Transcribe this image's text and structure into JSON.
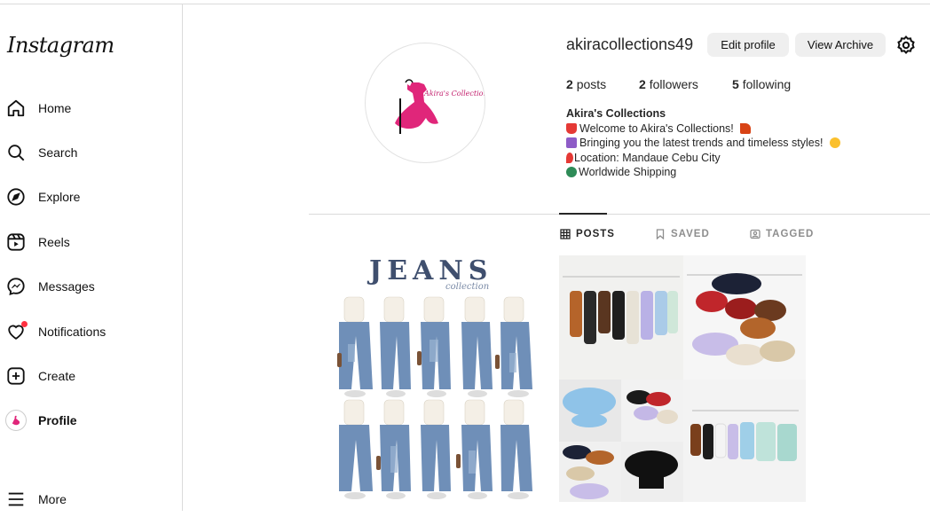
{
  "app": {
    "logo": "Instagram"
  },
  "sidebar": {
    "items": [
      {
        "label": "Home",
        "icon": "home-icon"
      },
      {
        "label": "Search",
        "icon": "search-icon"
      },
      {
        "label": "Explore",
        "icon": "compass-icon"
      },
      {
        "label": "Reels",
        "icon": "reels-icon"
      },
      {
        "label": "Messages",
        "icon": "messenger-icon"
      },
      {
        "label": "Notifications",
        "icon": "heart-icon",
        "badge": "dot"
      },
      {
        "label": "Create",
        "icon": "plus-square-icon"
      },
      {
        "label": "Profile",
        "icon": "avatar",
        "active": true
      },
      {
        "label": "More",
        "icon": "menu-icon"
      }
    ]
  },
  "profile": {
    "username": "akiracollections49",
    "edit_label": "Edit profile",
    "archive_label": "View Archive",
    "avatar_brand": "Akira's Collections",
    "stats": {
      "posts_count": "2",
      "posts_label": "posts",
      "followers_count": "2",
      "followers_label": "followers",
      "following_count": "5",
      "following_label": "following"
    },
    "bio": {
      "name": "Akira's Collections",
      "lines": [
        "Welcome to Akira's Collections!",
        "Bringing you the latest trends and timeless styles!",
        "Location: Mandaue Cebu City",
        "Worldwide Shipping"
      ]
    }
  },
  "tabs": [
    {
      "label": "POSTS",
      "active": true,
      "icon": "grid-icon"
    },
    {
      "label": "SAVED",
      "active": false,
      "icon": "bookmark-icon"
    },
    {
      "label": "TAGGED",
      "active": false,
      "icon": "tagged-icon"
    }
  ],
  "posts": [
    {
      "title": "JEANS",
      "subtitle": "collection"
    },
    {
      "title": ""
    }
  ],
  "colors": {
    "accent_pink": "#e0267a",
    "notification_red": "#ff3040",
    "denim": "#3f4f6e"
  }
}
